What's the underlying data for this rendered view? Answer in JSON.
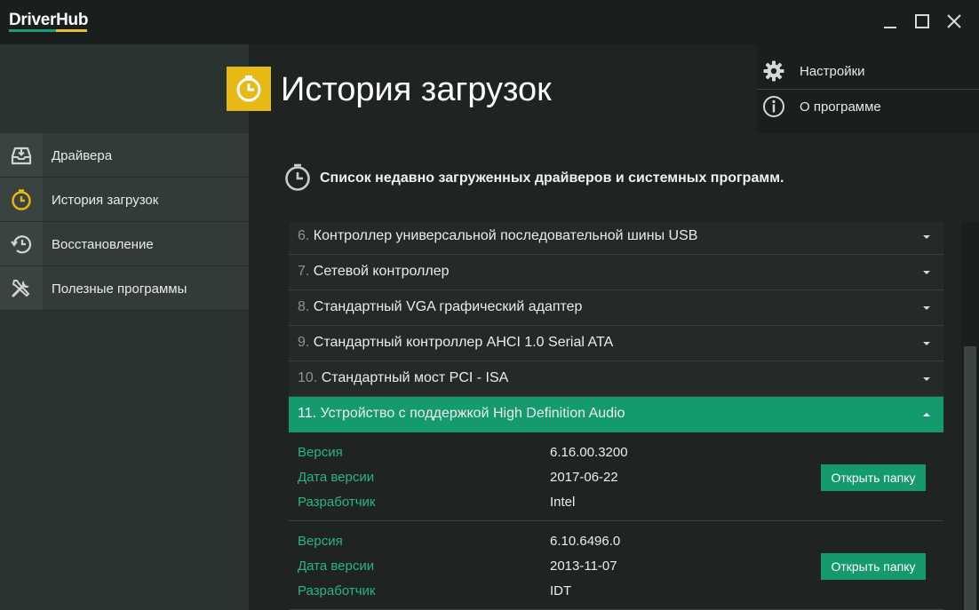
{
  "app": {
    "logo": "DriverHub",
    "brand_green": "#1a9e78",
    "brand_yellow": "#e8b915"
  },
  "window_controls": [
    "minimize-icon",
    "maximize-icon",
    "close-icon"
  ],
  "header": {
    "title": "История загрузок",
    "icon": "clock-icon"
  },
  "top_menu": [
    {
      "label": "Настройки",
      "icon": "gear-icon"
    },
    {
      "label": "О программе",
      "icon": "info-icon"
    }
  ],
  "sidebar": {
    "items": [
      {
        "label": "Драйвера",
        "icon": "drive-icon"
      },
      {
        "label": "История загрузок",
        "icon": "clock-icon",
        "active": true
      },
      {
        "label": "Восстановление",
        "icon": "history-icon"
      },
      {
        "label": "Полезные программы",
        "icon": "tools-icon"
      }
    ]
  },
  "content": {
    "subtitle": "Список недавно загруженных драйверов и системных программ."
  },
  "list": {
    "rows": [
      {
        "num": "6.",
        "label": "Контроллер универсальной последовательной шины USB"
      },
      {
        "num": "7.",
        "label": "Сетевой контроллер"
      },
      {
        "num": "8.",
        "label": "Стандартный VGA графический адаптер"
      },
      {
        "num": "9.",
        "label": "Стандартный контроллер AHCI 1.0 Serial ATA"
      },
      {
        "num": "10.",
        "label": "Стандартный мост PCI - ISA"
      },
      {
        "num": "11.",
        "label": "Устройство с поддержкой High Definition Audio",
        "expanded": true
      }
    ],
    "details": [
      {
        "version_label": "Версия",
        "version": "6.16.00.3200",
        "date_label": "Дата версии",
        "date": "2017-06-22",
        "dev_label": "Разработчик",
        "dev": "Intel",
        "button": "Открыть папку"
      },
      {
        "version_label": "Версия",
        "version": "6.10.6496.0",
        "date_label": "Дата версии",
        "date": "2013-11-07",
        "dev_label": "Разработчик",
        "dev": "IDT",
        "button": "Открыть папку"
      }
    ]
  }
}
